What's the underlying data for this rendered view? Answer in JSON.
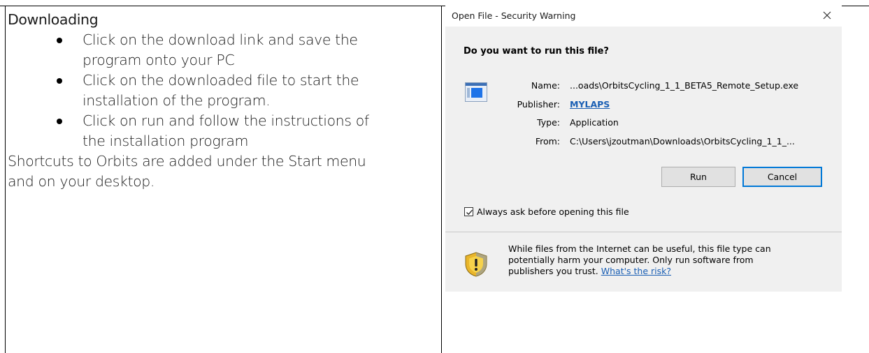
{
  "document": {
    "heading": "Downloading",
    "bullets": [
      {
        "line1": "Click on the download link and save the",
        "line2": "program onto your PC"
      },
      {
        "line1": "Click on the downloaded file to start the",
        "line2": "installation of the program."
      },
      {
        "line1": "Click on run and follow the instructions of",
        "line2": "the installation program"
      }
    ],
    "footer_line1": "Shortcuts to Orbits are added under the Start menu",
    "footer_line2": "and on your desktop."
  },
  "dialog": {
    "title": "Open File - Security Warning",
    "close_icon": "close-icon",
    "question": "Do you want to run this file?",
    "fields": {
      "name_label": "Name:",
      "name_value": "...oads\\OrbitsCycling_1_1_BETA5_Remote_Setup.exe",
      "publisher_label": "Publisher:",
      "publisher_value": "MYLAPS",
      "type_label": "Type:",
      "type_value": "Application",
      "from_label": "From:",
      "from_value": "C:\\Users\\jzoutman\\Downloads\\OrbitsCycling_1_1_..."
    },
    "run_label": "Run",
    "cancel_label": "Cancel",
    "checkbox_label": "Always ask before opening this file",
    "checkbox_checked": true,
    "warning_line1": "While files from the Internet can be useful, this file type can",
    "warning_line2": "potentially harm your computer. Only run software from",
    "warning_line3": "publishers you trust.",
    "risk_link": "What's the risk?",
    "colors": {
      "link": "#1a5fb4",
      "dialog_bg": "#f0f0f0",
      "focus_border": "#0078d7"
    }
  }
}
